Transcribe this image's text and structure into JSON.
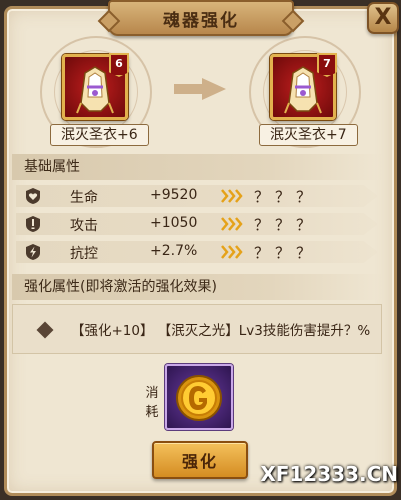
{
  "window": {
    "title": "魂器强化",
    "close_label": "X"
  },
  "items": {
    "current": {
      "name": "泯灭圣衣+6",
      "level": "6"
    },
    "next": {
      "name": "泯灭圣衣+7",
      "level": "7"
    }
  },
  "base_attributes": {
    "header": "基础属性",
    "rows": [
      {
        "icon": "heart-shield-icon",
        "name": "生命",
        "value": "+9520",
        "next": "？？？"
      },
      {
        "icon": "attack-icon",
        "name": "攻击",
        "value": "+1050",
        "next": "？？？"
      },
      {
        "icon": "resist-control-icon",
        "name": "抗控",
        "value": "+2.7%",
        "next": "？？？"
      }
    ]
  },
  "enhance_attributes": {
    "header": "强化属性(即将激活的强化效果)",
    "effect": "【强化+10】  【泯灭之光】Lv3技能伤害提升？%"
  },
  "cost": {
    "label": "消耗"
  },
  "actions": {
    "enhance_label": "强化"
  },
  "watermark": {
    "text": "XF12333.CN"
  },
  "colors": {
    "accent": "#e2b24e",
    "panel": "#efe6d2",
    "frame_red": "#c01e1e",
    "button": "#e9a53c"
  }
}
